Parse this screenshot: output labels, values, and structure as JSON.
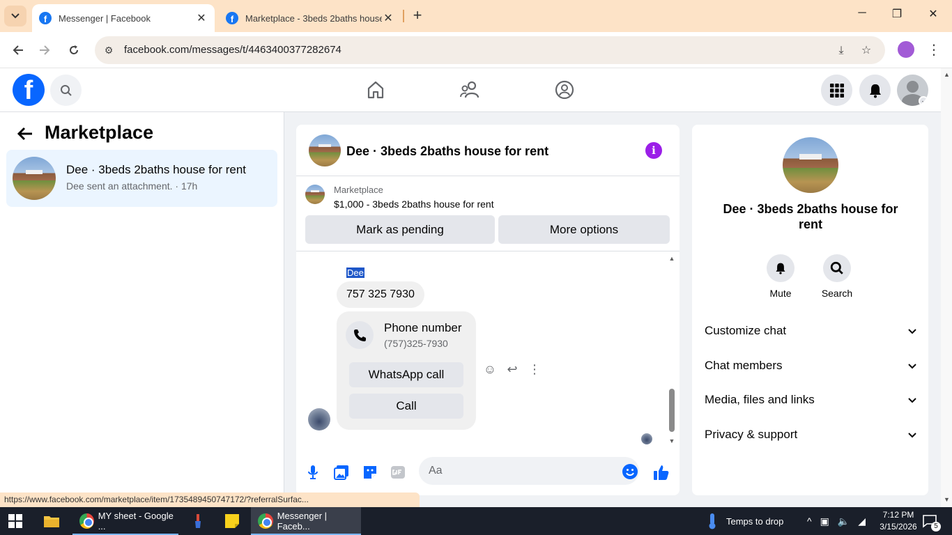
{
  "browser": {
    "tabs": [
      {
        "title": "Messenger | Facebook",
        "active": true
      },
      {
        "title": "Marketplace - 3beds 2baths house",
        "active": false
      }
    ],
    "url": "facebook.com/messages/t/4463400377282674",
    "status_url": "https://www.facebook.com/marketplace/item/1735489450747172/?referralSurfac..."
  },
  "fb": {
    "logo": "f"
  },
  "left_panel": {
    "title": "Marketplace",
    "threads": [
      {
        "name": "Dee · 3beds 2baths house for rent",
        "snippet": "Dee sent an attachment. · 17h"
      }
    ]
  },
  "chat": {
    "header_name": "Dee · 3beds 2baths house for rent",
    "marketplace_label": "Marketplace",
    "listing": "$1,000 - 3beds 2baths house for rent",
    "mark_pending_label": "Mark as pending",
    "more_options_label": "More options",
    "sender_name": "Dee",
    "message_text": "757 325 7930",
    "card": {
      "title": "Phone number",
      "number": "(757)325-7930",
      "whatsapp_label": "WhatsApp call",
      "call_label": "Call"
    },
    "composer_placeholder": "Aa"
  },
  "right_panel": {
    "name": "Dee · 3beds 2baths house for rent",
    "mute_label": "Mute",
    "search_label": "Search",
    "sections": [
      "Customize chat",
      "Chat members",
      "Media, files and links",
      "Privacy & support"
    ]
  },
  "taskbar": {
    "items": [
      "MY sheet - Google ...",
      "Messenger | Faceb..."
    ],
    "weather": "Temps to drop",
    "time": "7:12 PM",
    "date": "3/15/2026",
    "notif_count": "5"
  },
  "colors": {
    "fb_blue": "#0866ff",
    "messenger_purple": "#9b1fe8",
    "selected_thread": "#ebf5ff",
    "tabbar": "#fde3c7"
  }
}
